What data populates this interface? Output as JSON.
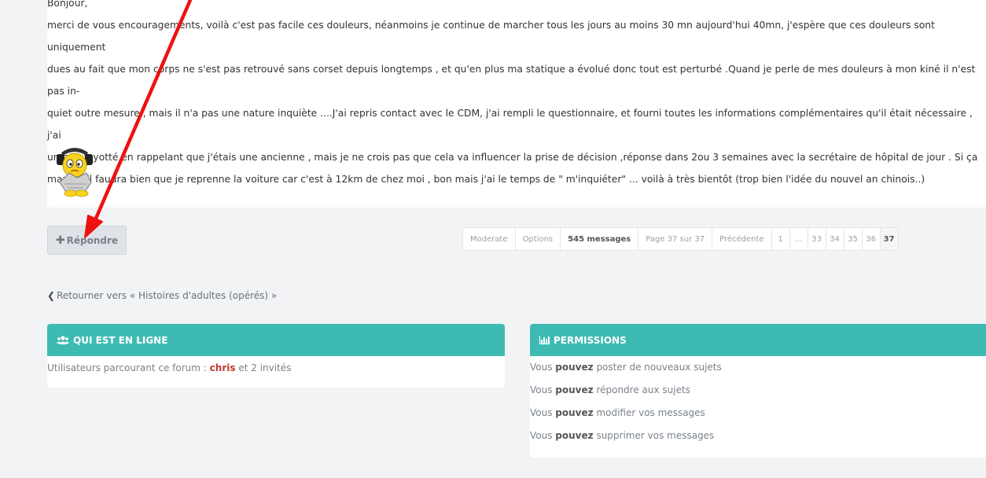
{
  "post": {
    "greeting": "Bonjour,",
    "lines": [
      "merci de vous encouragements, voilà c'est pas facile ces douleurs, néanmoins je continue de marcher tous les jours au moins 30 mn aujourd'hui 40mn, j'espère que ces douleurs sont uniquement",
      "dues au fait que mon corps ne s'est pas retrouvé sans corset depuis longtemps , et qu'en plus ma statique a évolué donc tout est perturbé .Quand je perle de mes douleurs à mon kiné il n'est pas in-",
      "quiet outre mesure , mais il n'a pas une nature inquiète ....J'ai repris contact avec le CDM, j'ai rempli le questionnaire, et fourni toutes les informations complémentaires qu'il était nécessaire , j'ai",
      "un peu fayotté en rappelant que j'étais une ancienne , mais je ne crois pas que cela va influencer la prise de décision ,réponse dans 2ou 3 semaines avec la secrétaire de hôpital de jour . Si ça",
      "marche il faudra bien que je reprenne la voiture car c'est à 12km de chez moi , bon mais j'ai le temps de \" m'inquiéter\" ... voilà à très bientôt (trop bien l'idée du nouvel an chinois..)"
    ]
  },
  "actions": {
    "reply_icon": "plus-icon",
    "reply_label": "Répondre"
  },
  "pagination": {
    "moderate": "Moderate",
    "options": "Options",
    "count": "545 messages",
    "page": "Page 37 sur 37",
    "previous": "Précédente",
    "pages": [
      "1",
      "…",
      "33",
      "34",
      "35",
      "36",
      "37"
    ]
  },
  "back_link": {
    "icon": "chevron-left-icon",
    "label": "Retourner vers « Histoires d'adultes (opérés) »"
  },
  "online": {
    "title": "QUI EST EN LIGNE",
    "icon": "users-icon",
    "prefix": "Utilisateurs parcourant ce forum : ",
    "user": "chris",
    "suffix": " et 2 invités"
  },
  "permissions": {
    "title": "PERMISSIONS",
    "icon": "bar-chart-icon",
    "items": [
      {
        "pre": "Vous ",
        "strong": "pouvez",
        "post": " poster de nouveaux sujets"
      },
      {
        "pre": "Vous ",
        "strong": "pouvez",
        "post": " répondre aux sujets"
      },
      {
        "pre": "Vous ",
        "strong": "pouvez",
        "post": " modifier vos messages"
      },
      {
        "pre": "Vous ",
        "strong": "pouvez",
        "post": " supprimer vos messages"
      }
    ]
  },
  "colors": {
    "panel_header": "#3dbbb2",
    "user_link": "#c0392b",
    "arrow": "#ee1111"
  }
}
